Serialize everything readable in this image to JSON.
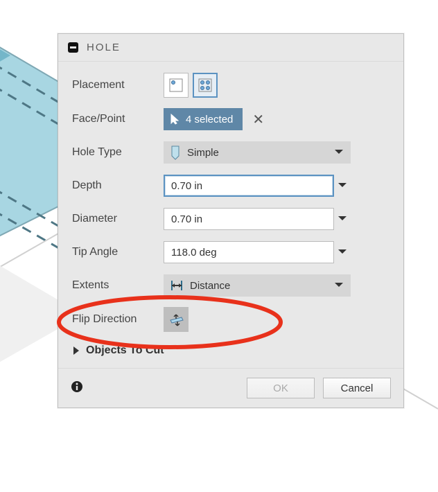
{
  "panel": {
    "title": "HOLE",
    "rows": {
      "placement": {
        "label": "Placement"
      },
      "facepoint": {
        "label": "Face/Point",
        "chip": "4 selected"
      },
      "holetype": {
        "label": "Hole Type",
        "value": "Simple"
      },
      "depth": {
        "label": "Depth",
        "value": "0.70 in"
      },
      "diameter": {
        "label": "Diameter",
        "value": "0.70 in"
      },
      "tipangle": {
        "label": "Tip Angle",
        "value": "118.0 deg"
      },
      "extents": {
        "label": "Extents",
        "value": "Distance"
      },
      "flip": {
        "label": "Flip Direction"
      }
    },
    "expand": {
      "label": "Objects To Cut"
    },
    "footer": {
      "ok": "OK",
      "cancel": "Cancel"
    }
  }
}
